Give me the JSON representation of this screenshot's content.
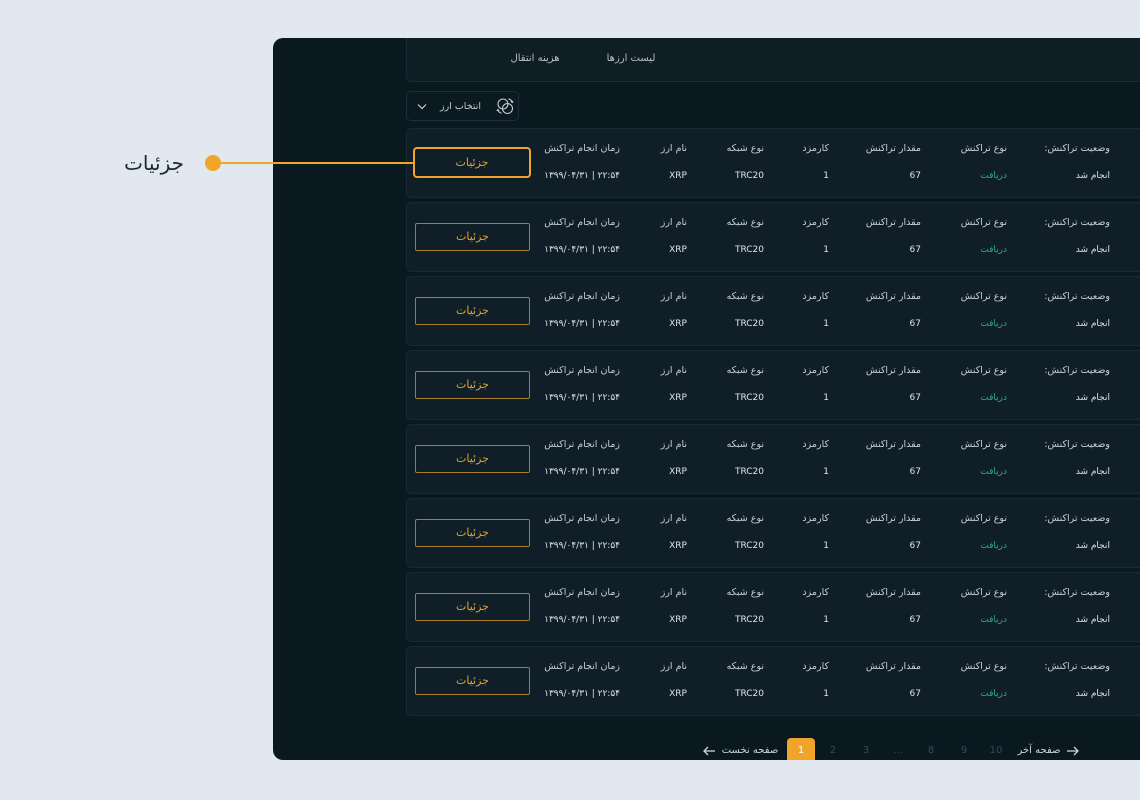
{
  "annotation": {
    "label": "جزئیات"
  },
  "tabs": [
    {
      "label": "لیست ارزها"
    },
    {
      "label": "هزینه انتقال"
    }
  ],
  "currency_select": {
    "label": "انتخاب ارز",
    "icon": "coins-exchange-icon",
    "chevron_icon": "chevron-down-icon"
  },
  "columns": {
    "status": "وضعیت تراکنش:",
    "type": "نوع تراکنش",
    "amount": "مقدار تراکنش",
    "fee": "کارمزد",
    "network": "نوع شبکه",
    "currency": "نام ارز",
    "time": "زمان انجام تراکنش"
  },
  "transactions": [
    {
      "status": "انجام شد",
      "type": "دریافت",
      "amount": "67",
      "fee": "1",
      "network": "TRC20",
      "currency": "XRP",
      "time": "۱۳۹۹/۰۴/۳۱ | ۲۲:۵۴",
      "details_label": "جزئیات"
    },
    {
      "status": "انجام شد",
      "type": "دریافت",
      "amount": "67",
      "fee": "1",
      "network": "TRC20",
      "currency": "XRP",
      "time": "۱۳۹۹/۰۴/۳۱ | ۲۲:۵۴",
      "details_label": "جزئیات"
    },
    {
      "status": "انجام شد",
      "type": "دریافت",
      "amount": "67",
      "fee": "1",
      "network": "TRC20",
      "currency": "XRP",
      "time": "۱۳۹۹/۰۴/۳۱ | ۲۲:۵۴",
      "details_label": "جزئیات"
    },
    {
      "status": "انجام شد",
      "type": "دریافت",
      "amount": "67",
      "fee": "1",
      "network": "TRC20",
      "currency": "XRP",
      "time": "۱۳۹۹/۰۴/۳۱ | ۲۲:۵۴",
      "details_label": "جزئیات"
    },
    {
      "status": "انجام شد",
      "type": "دریافت",
      "amount": "67",
      "fee": "1",
      "network": "TRC20",
      "currency": "XRP",
      "time": "۱۳۹۹/۰۴/۳۱ | ۲۲:۵۴",
      "details_label": "جزئیات"
    },
    {
      "status": "انجام شد",
      "type": "دریافت",
      "amount": "67",
      "fee": "1",
      "network": "TRC20",
      "currency": "XRP",
      "time": "۱۳۹۹/۰۴/۳۱ | ۲۲:۵۴",
      "details_label": "جزئیات"
    },
    {
      "status": "انجام شد",
      "type": "دریافت",
      "amount": "67",
      "fee": "1",
      "network": "TRC20",
      "currency": "XRP",
      "time": "۱۳۹۹/۰۴/۳۱ | ۲۲:۵۴",
      "details_label": "جزئیات"
    },
    {
      "status": "انجام شد",
      "type": "دریافت",
      "amount": "67",
      "fee": "1",
      "network": "TRC20",
      "currency": "XRP",
      "time": "۱۳۹۹/۰۴/۳۱ | ۲۲:۵۴",
      "details_label": "جزئیات"
    }
  ],
  "pagination": {
    "first_label": "صفحه نخست",
    "last_label": "صفحه آخر",
    "first_icon": "arrow-left-icon",
    "last_icon": "arrow-right-icon",
    "pages": [
      {
        "label": "1",
        "active": true
      },
      {
        "label": "2",
        "active": false
      },
      {
        "label": "3",
        "active": false
      },
      {
        "label": "...",
        "active": false
      },
      {
        "label": "8",
        "active": false
      },
      {
        "label": "9",
        "active": false
      },
      {
        "label": "10",
        "active": false
      }
    ]
  },
  "colors": {
    "page_bg": "#e2e8ef",
    "panel_bg": "#0a1820",
    "card_bg": "#101e27",
    "accent": "#f0a52a",
    "success": "#2bb07f",
    "annotation_text": "#1c2935"
  }
}
